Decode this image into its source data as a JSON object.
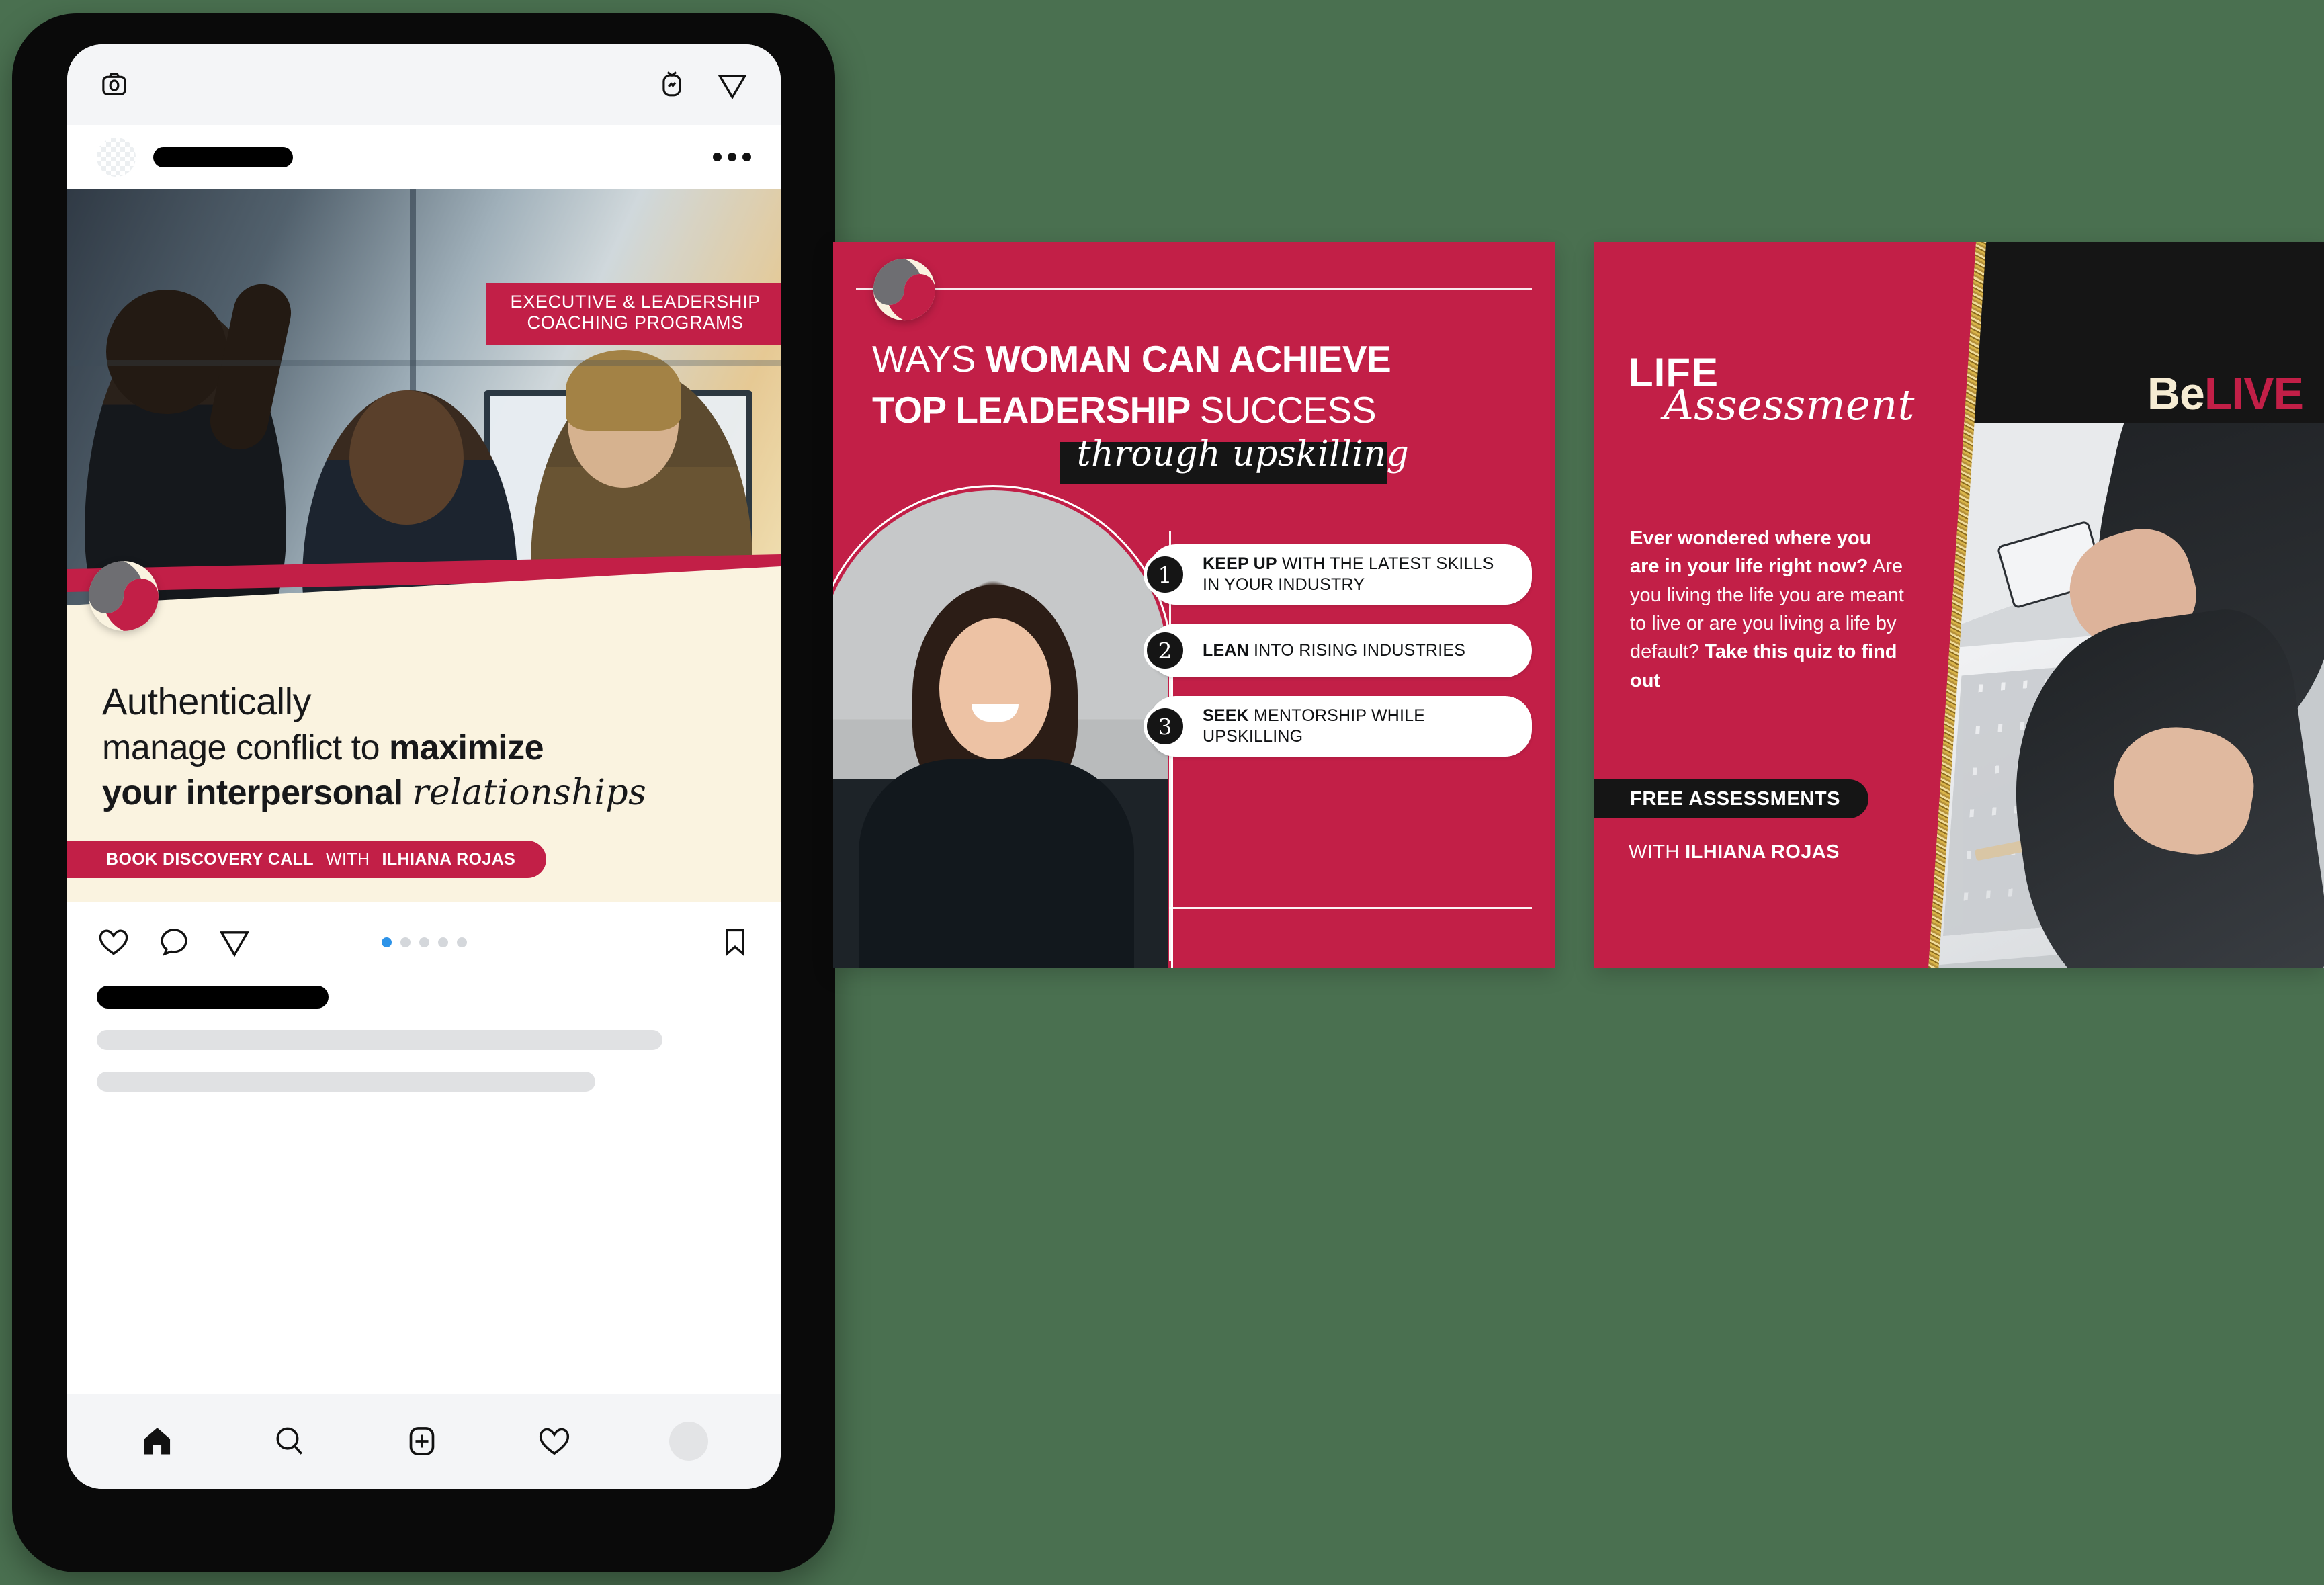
{
  "page": {
    "background_color": "#4A7050",
    "brand_crimson": "#C21F47",
    "brand_cream": "#FAF3E0",
    "brand_black": "#151515",
    "brand_gold": "#D9B44A"
  },
  "phone": {
    "topbar": {
      "camera_icon": "camera-icon",
      "igtv_icon": "igtv-icon",
      "send_icon": "send-icon"
    },
    "post_header": {
      "avatar": "avatar-placeholder",
      "username_redacted": "",
      "more_icon": "more-options-icon"
    },
    "actions": {
      "like_icon": "heart-icon",
      "comment_icon": "comment-icon",
      "share_icon": "share-icon",
      "bookmark_icon": "bookmark-icon",
      "carousel_total": 5,
      "carousel_active_index": 1
    },
    "caption": {
      "username_bar": "",
      "line_1": "",
      "line_2": ""
    },
    "bottom_nav": {
      "home_icon": "home-icon",
      "search_icon": "search-icon",
      "add_icon": "add-post-icon",
      "activity_icon": "heart-icon",
      "profile_icon": "profile-avatar-icon"
    }
  },
  "card_1": {
    "tag_line_1": "EXECUTIVE & LEADERSHIP",
    "tag_line_2": "COACHING PROGRAMS",
    "headline_line_1": "Authentically",
    "headline_line_2_plain": "manage conflict to ",
    "headline_line_2_bold": "maximize",
    "headline_line_3_bold": "your interpersonal ",
    "headline_line_3_script": "relationships",
    "cta_bold": "BOOK DISCOVERY CALL",
    "cta_with": "WITH",
    "cta_name": "ILHIANA ROJAS",
    "logo": "belive-swirl-logo"
  },
  "card_2": {
    "logo": "belive-swirl-logo",
    "title_line_1_plain": "WAYS ",
    "title_line_1_bold": "WOMAN CAN ACHIEVE",
    "title_line_2_bold": "TOP LEADERSHIP ",
    "title_line_2_plain": "SUCCESS",
    "script_text": "through upskilling",
    "list": [
      {
        "number": "1",
        "bold": "KEEP UP",
        "rest": " WITH THE LATEST SKILLS IN YOUR INDUSTRY"
      },
      {
        "number": "2",
        "bold": "LEAN",
        "rest": " INTO RISING INDUSTRIES"
      },
      {
        "number": "3",
        "bold": "SEEK",
        "rest": " MENTORSHIP WHILE UPSKILLING"
      }
    ]
  },
  "card_3": {
    "title_bold": "LIFE",
    "title_script": "Assessment",
    "logo_be": "Be",
    "logo_live": "LIVE",
    "body_bold_1": "Ever wondered where you are in your life right now?",
    "body_light": " Are you living the life you are meant to live or are you living a life by default? ",
    "body_bold_2": "Take this quiz to find out",
    "badge": "FREE ASSESSMENTS",
    "with_label": "WITH ",
    "with_name": "ILHIANA ROJAS"
  }
}
